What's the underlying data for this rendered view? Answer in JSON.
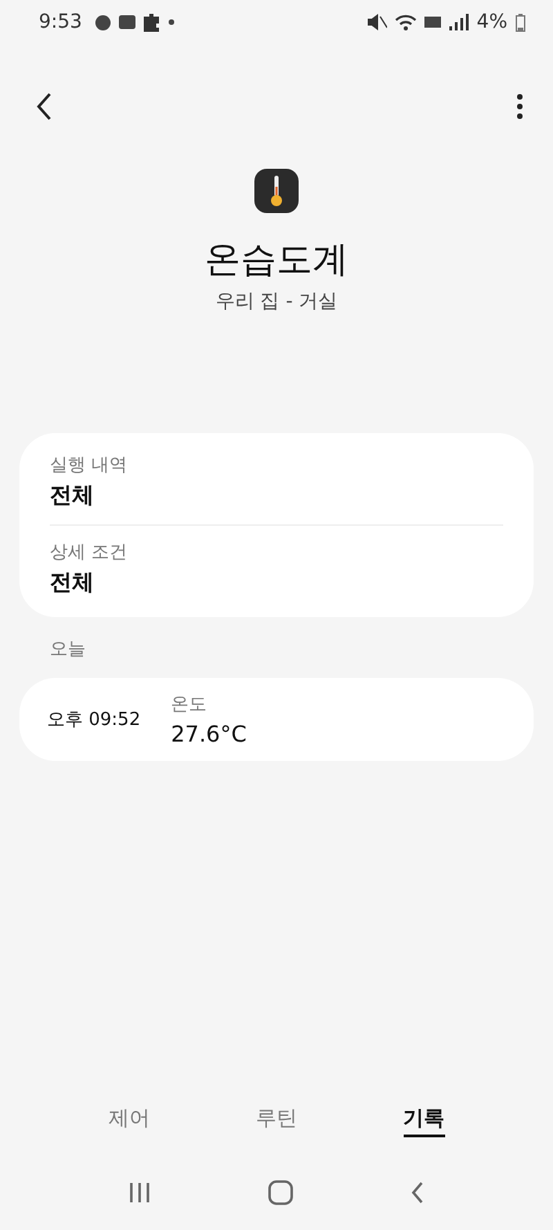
{
  "status_bar": {
    "time": "9:53",
    "battery": "4%"
  },
  "device": {
    "name": "온습도계",
    "location": "우리 집 - 거실"
  },
  "filters": [
    {
      "label": "실행 내역",
      "value": "전체"
    },
    {
      "label": "상세 조건",
      "value": "전체"
    }
  ],
  "section_title": "오늘",
  "records": [
    {
      "time": "오후 09:52",
      "label": "온도",
      "value": "27.6°C"
    }
  ],
  "tabs": [
    {
      "label": "제어",
      "selected": false
    },
    {
      "label": "루틴",
      "selected": false
    },
    {
      "label": "기록",
      "selected": true
    }
  ]
}
